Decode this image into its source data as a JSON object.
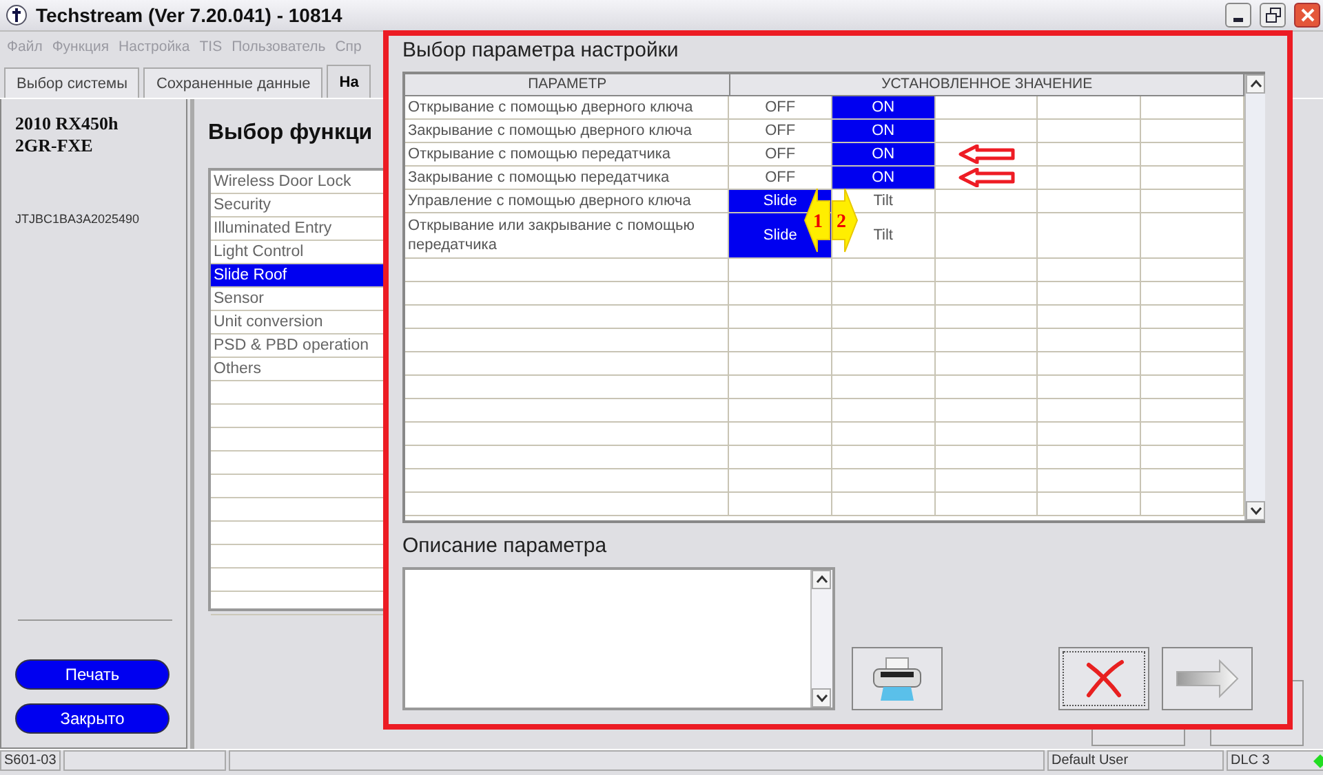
{
  "window": {
    "title": "Techstream (Ver 7.20.041) - 10814"
  },
  "menu": [
    "Файл",
    "Функция",
    "Настройка",
    "TIS",
    "Пользователь",
    "Спр"
  ],
  "tabs": [
    {
      "label": "Выбор системы",
      "selected": false
    },
    {
      "label": "Сохраненные данные",
      "selected": false
    },
    {
      "label": "На",
      "selected": true
    }
  ],
  "vehicle": {
    "model": "2010 RX450h",
    "engine": "2GR-FXE",
    "vin": "JTJBC1BA3A2025490"
  },
  "side_buttons": [
    "Печать",
    "Закрыто"
  ],
  "function_panel": {
    "heading": "Выбор функци",
    "items": [
      {
        "label": "Wireless Door Lock",
        "selected": false
      },
      {
        "label": "Security",
        "selected": false
      },
      {
        "label": "Illuminated Entry",
        "selected": false
      },
      {
        "label": "Light Control",
        "selected": false
      },
      {
        "label": "Slide Roof",
        "selected": true
      },
      {
        "label": "Sensor",
        "selected": false
      },
      {
        "label": "Unit conversion",
        "selected": false
      },
      {
        "label": "PSD & PBD operation",
        "selected": false
      },
      {
        "label": "Others",
        "selected": false
      }
    ]
  },
  "dialog": {
    "title": "Выбор параметра настройки",
    "columns": [
      "ПАРАМЕТР",
      "УСТАНОВЛЕННОЕ ЗНАЧЕНИЕ"
    ],
    "rows": [
      {
        "parameter": "Открывание с помощью дверного ключа",
        "marked": false,
        "values": [
          {
            "text": "OFF",
            "selected": false
          },
          {
            "text": "ON",
            "selected": true
          }
        ]
      },
      {
        "parameter": "Закрывание с помощью дверного ключа",
        "marked": false,
        "values": [
          {
            "text": "OFF",
            "selected": false
          },
          {
            "text": "ON",
            "selected": true
          }
        ]
      },
      {
        "parameter": "Открывание с помощью передатчика",
        "marked": true,
        "values": [
          {
            "text": "OFF",
            "selected": false
          },
          {
            "text": "ON",
            "selected": true
          }
        ]
      },
      {
        "parameter": "Закрывание с помощью передатчика",
        "marked": true,
        "values": [
          {
            "text": "OFF",
            "selected": false
          },
          {
            "text": "ON",
            "selected": true
          }
        ]
      },
      {
        "parameter": "Управление с помощью дверного ключа",
        "marked": false,
        "values": [
          {
            "text": "Slide",
            "selected": true
          },
          {
            "text": "Tilt",
            "selected": false
          }
        ]
      },
      {
        "parameter": "Открывание или закрывание с помощью передатчика",
        "marked": false,
        "values": [
          {
            "text": "Slide",
            "selected": true
          },
          {
            "text": "Tilt",
            "selected": false
          }
        ]
      }
    ],
    "annotations": [
      {
        "label": "1",
        "kind": "left"
      },
      {
        "label": "2",
        "kind": "right"
      }
    ],
    "description_label": "Описание параметра"
  },
  "status_bar": {
    "code": "S601-03",
    "user": "Default User",
    "link": "DLC 3"
  }
}
